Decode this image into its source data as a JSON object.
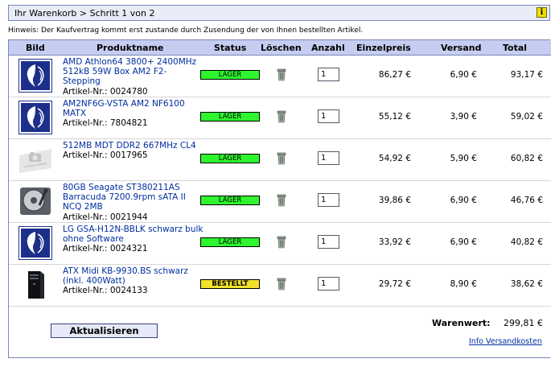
{
  "header": {
    "title": "Ihr Warenkorb > Schritt 1 von 2",
    "info_icon": "i"
  },
  "hint": "Hinweis: Der Kaufvertrag kommt erst zustande durch Zusendung der von Ihnen bestellten Artikel.",
  "columns": {
    "bild": "Bild",
    "produktname": "Produktname",
    "status": "Status",
    "loeschen": "Löschen",
    "anzahl": "Anzahl",
    "einzelpreis": "Einzelpreis",
    "versand": "Versand",
    "total": "Total"
  },
  "article_prefix": "Artikel-Nr.:",
  "items": [
    {
      "name": "AMD Athlon64 3800+ 2400MHz 512kB 59W Box AM2 F2-Stepping",
      "article": "0024780",
      "status": "LAGER",
      "status_type": "lager",
      "qty": "1",
      "unit_price": "86,27 €",
      "shipping": "6,90 €",
      "total": "93,17 €",
      "thumb": "logo"
    },
    {
      "name": "AM2NF6G-VSTA AM2 NF6100 MATX",
      "article": "7804821",
      "status": "LAGER",
      "status_type": "lager",
      "qty": "1",
      "unit_price": "55,12 €",
      "shipping": "3,90 €",
      "total": "59,02 €",
      "thumb": "logo"
    },
    {
      "name": "512MB MDT DDR2 667MHz CL4",
      "article": "0017965",
      "status": "LAGER",
      "status_type": "lager",
      "qty": "1",
      "unit_price": "54,92 €",
      "shipping": "5,90 €",
      "total": "60,82 €",
      "thumb": "noimage",
      "thumb_text": "no image available"
    },
    {
      "name": "80GB Seagate ST380211AS Barracuda 7200.9rpm sATA II NCQ 2MB",
      "article": "0021944",
      "status": "LAGER",
      "status_type": "lager",
      "qty": "1",
      "unit_price": "39,86 €",
      "shipping": "6,90 €",
      "total": "46,76 €",
      "thumb": "hdd"
    },
    {
      "name": "LG GSA-H12N-BBLK schwarz bulk ohne Software",
      "article": "0024321",
      "status": "LAGER",
      "status_type": "lager",
      "qty": "1",
      "unit_price": "33,92 €",
      "shipping": "6,90 €",
      "total": "40,82 €",
      "thumb": "logo"
    },
    {
      "name": "ATX Midi KB-9930.BS schwarz (inkl. 400Watt)",
      "article": "0024133",
      "status": "BESTELLT",
      "status_type": "bestellt",
      "qty": "1",
      "unit_price": "29,72 €",
      "shipping": "8,90 €",
      "total": "38,62 €",
      "thumb": "case"
    }
  ],
  "footer": {
    "update_label": "Aktualisieren",
    "warenwert_label": "Warenwert:",
    "warenwert_value": "299,81 €",
    "shipping_info_link": "Info Versandkosten"
  },
  "colors": {
    "lager": "#2ef52e",
    "bestellt": "#f2e22c",
    "header_bg": "#c6cdf0",
    "border": "#7a86b8",
    "link": "#002ea0"
  }
}
